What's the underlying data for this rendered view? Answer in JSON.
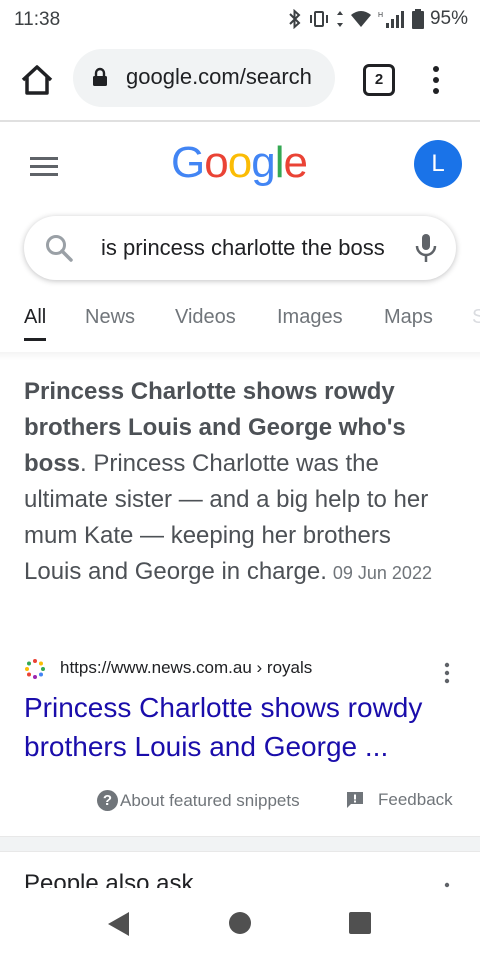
{
  "status_bar": {
    "time": "11:38",
    "battery": "95%"
  },
  "browser": {
    "url": "google.com/search",
    "tab_count": "2"
  },
  "google": {
    "logo": [
      "G",
      "o",
      "o",
      "g",
      "l",
      "e"
    ],
    "logo_colors": [
      "#4285F4",
      "#EA4335",
      "#FBBC05",
      "#4285F4",
      "#34A853",
      "#EA4335"
    ],
    "avatar_letter": "L",
    "query": "is princess charlotte the boss"
  },
  "tabs": [
    "All",
    "News",
    "Videos",
    "Images",
    "Maps",
    "S"
  ],
  "snippet": {
    "bold": "Princess Charlotte shows rowdy brothers Louis and George who's boss",
    "text": ". Princess Charlotte was the ultimate sister — and a big help to her mum Kate — keeping her brothers Louis and George in charge.",
    "date": "09 Jun 2022"
  },
  "source": {
    "url": "https://www.news.com.au › royals"
  },
  "result_title": "Princess Charlotte shows rowdy brothers Louis and George ...",
  "links": {
    "about": "About featured snippets",
    "feedback": "Feedback"
  },
  "people_also_ask": "People also ask",
  "colors": {
    "link": "#1a0dab",
    "accent": "#1a73e8"
  }
}
